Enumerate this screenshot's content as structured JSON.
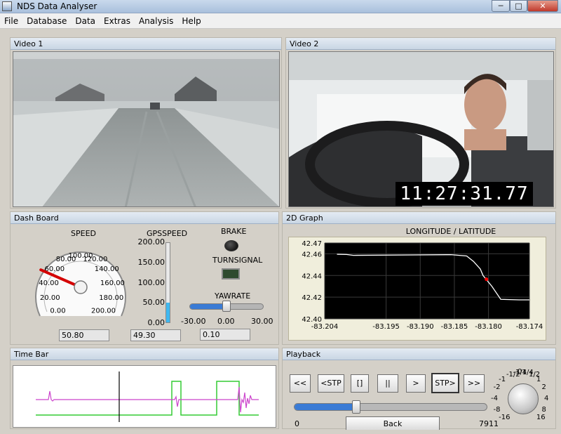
{
  "window": {
    "title": "NDS Data Analyser",
    "minimize": "─",
    "maximize": "□",
    "close": "✕"
  },
  "menu": [
    "File",
    "Database",
    "Data",
    "Extras",
    "Analysis",
    "Help"
  ],
  "video1": {
    "title": "Video 1"
  },
  "video2": {
    "title": "Video 2",
    "timestamp": "11:27:31.77"
  },
  "dashboard": {
    "title": "Dash Board",
    "speed": {
      "label": "SPEED",
      "ticks": [
        "0.00",
        "20.00",
        "40.00",
        "60.00",
        "80.00",
        "100.00",
        "120.00",
        "140.00",
        "160.00",
        "180.00",
        "200.00"
      ],
      "value": "50.80",
      "needle_value": 50.8,
      "max": 200
    },
    "gpsspeed": {
      "label": "GPSSPEED",
      "ticks": [
        "200.00",
        "150.00",
        "100.00",
        "50.00",
        "0.00"
      ],
      "value": "49.30",
      "fill_value": 49.3,
      "max": 200
    },
    "brake": {
      "label": "BRAKE"
    },
    "turnsignal": {
      "label": "TURNSIGNAL"
    },
    "yawrate": {
      "label": "YAWRATE",
      "ticks": [
        "-30.00",
        "0.00",
        "30.00"
      ],
      "value": "0.10",
      "slider_value": 0.1,
      "min": -30,
      "max": 30
    }
  },
  "graph2d": {
    "title": "2D Graph"
  },
  "chart_data": {
    "type": "line",
    "title": "LONGITUDE / LATITUDE",
    "xlabel": "",
    "ylabel": "",
    "xlim": [
      -83.204,
      -83.174
    ],
    "ylim": [
      42.4,
      42.47
    ],
    "x_ticks": [
      "-83.204",
      "-83.195",
      "-83.190",
      "-83.185",
      "-83.180",
      "-83.174"
    ],
    "y_ticks": [
      "42.47",
      "42.46",
      "42.44",
      "42.42",
      "42.40"
    ],
    "grid": true,
    "series": [
      {
        "color": "#ffffff",
        "x": [
          -83.2022,
          -83.2008,
          -83.1998,
          -83.1908,
          -83.1855,
          -83.1832,
          -83.1822,
          -83.1812,
          -83.1808,
          -83.1795,
          -83.1782,
          -83.1755,
          -83.174
        ],
        "y": [
          42.4596,
          42.4594,
          42.4586,
          42.459,
          42.4592,
          42.458,
          42.453,
          42.446,
          42.44,
          42.43,
          42.418,
          42.4175,
          42.4175
        ]
      }
    ],
    "marker": {
      "x": -83.1803,
      "y": 42.4365,
      "color": "#ff0000"
    }
  },
  "timebar": {
    "title": "Time Bar"
  },
  "playback": {
    "title": "Playback",
    "buttons": [
      "<<",
      "<STP",
      "[]",
      "||",
      ">",
      "STP>",
      ">>"
    ],
    "slider_min": "0",
    "slider_max": "7911",
    "position_fraction": 0.32,
    "back_label": "Back",
    "knob_ticks": [
      "-1/2",
      "-1/4",
      "0",
      "1/4",
      "1/2",
      "-1",
      "1",
      "-2",
      "2",
      "-4",
      "4",
      "-8",
      "8",
      "-16",
      "16"
    ]
  },
  "colors": {
    "accent": "#3a7bd5",
    "plot_bg": "#000000",
    "pink_trace": "#cc44cc",
    "green_trace": "#33cc33"
  }
}
